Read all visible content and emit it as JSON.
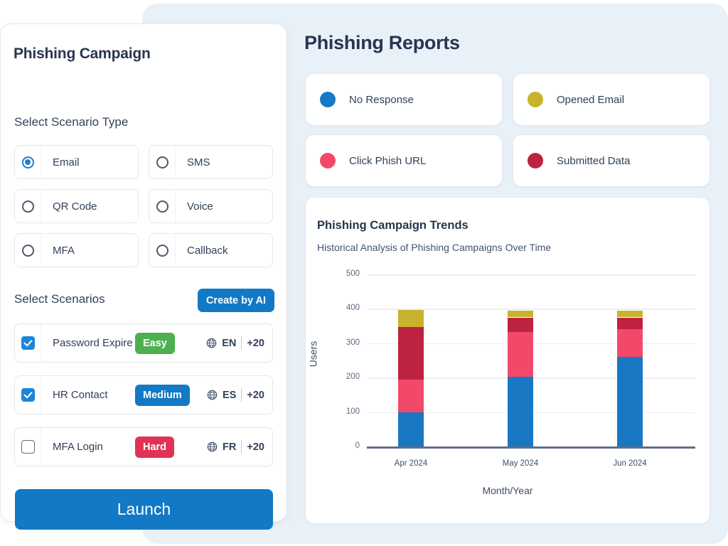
{
  "left_panel": {
    "title": "Phishing Campaign",
    "scenario_type_label": "Select Scenario Type",
    "scenario_types": [
      {
        "label": "Email",
        "selected": true
      },
      {
        "label": "SMS",
        "selected": false
      },
      {
        "label": "QR Code",
        "selected": false
      },
      {
        "label": "Voice",
        "selected": false
      },
      {
        "label": "MFA",
        "selected": false
      },
      {
        "label": "Callback",
        "selected": false
      }
    ],
    "scenarios_label": "Select Scenarios",
    "create_by_ai_label": "Create by AI",
    "scenarios": [
      {
        "name": "Password Expire",
        "difficulty": "Easy",
        "difficulty_color": "#4caf50",
        "lang": "EN",
        "more": "+20",
        "checked": true
      },
      {
        "name": "HR Contact",
        "difficulty": "Medium",
        "difficulty_color": "#1279c6",
        "lang": "ES",
        "more": "+20",
        "checked": true
      },
      {
        "name": "MFA Login",
        "difficulty": "Hard",
        "difficulty_color": "#e03256",
        "lang": "FR",
        "more": "+20",
        "checked": false
      }
    ],
    "launch_label": "Launch"
  },
  "right_panel": {
    "title": "Phishing Reports",
    "legend": [
      {
        "label": "No Response",
        "color": "#1878c4"
      },
      {
        "label": "Opened Email",
        "color": "#c9b22e"
      },
      {
        "label": "Click Phish URL",
        "color": "#f2496b"
      },
      {
        "label": "Submitted Data",
        "color": "#bd2240"
      }
    ]
  },
  "chart_data": {
    "type": "bar",
    "stacked": true,
    "title": "Phishing Campaign Trends",
    "subtitle": "Historical Analysis of Phishing Campaigns Over Time",
    "xlabel": "Month/Year",
    "ylabel": "Users",
    "categories": [
      "Apr 2024",
      "May 2024",
      "Jun 2024"
    ],
    "yticks": [
      0,
      100,
      200,
      300,
      400,
      500
    ],
    "ylim": [
      0,
      500
    ],
    "grid": true,
    "legend_position": "top-external",
    "series": [
      {
        "name": "No Response",
        "color": "#1878c4",
        "values": [
          100,
          202,
          260
        ]
      },
      {
        "name": "Click Phish URL",
        "color": "#f2496b",
        "values": [
          95,
          131,
          80
        ]
      },
      {
        "name": "Submitted Data",
        "color": "#bd2240",
        "values": [
          153,
          42,
          35
        ]
      },
      {
        "name": "Opened Email",
        "color": "#c9b22e",
        "values": [
          49,
          20,
          20
        ]
      }
    ]
  },
  "icons": {
    "globe": "globe-icon",
    "radio": "radio-icon",
    "checkbox": "checkbox-icon"
  }
}
